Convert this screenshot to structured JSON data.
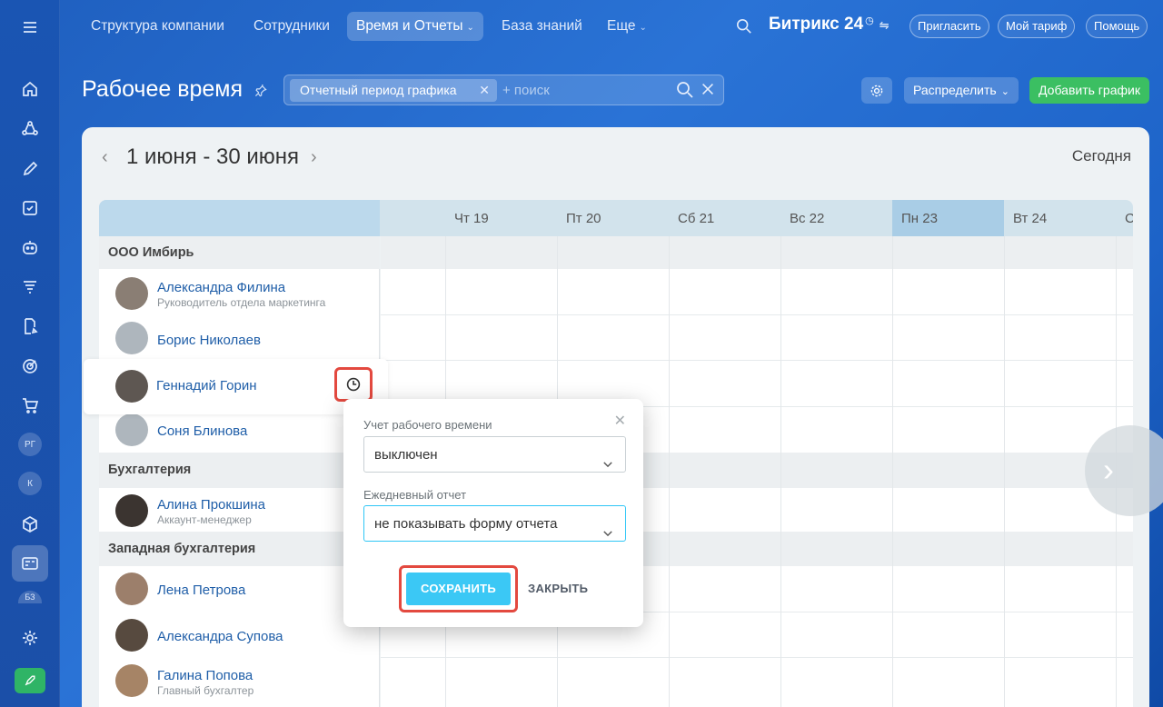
{
  "topnav": {
    "menu_icon": "hamburger-icon",
    "items": [
      {
        "label": "Структура компании"
      },
      {
        "label": "Сотрудники"
      },
      {
        "label": "Время и Отчеты"
      },
      {
        "label": "База знаний"
      },
      {
        "label": "Еще"
      }
    ],
    "brand": "Битрикс 24",
    "invite": "Пригласить",
    "tariff": "Мой тариф",
    "help": "Помощь"
  },
  "sidebar": {
    "badges": [
      "РГ",
      "К",
      "БЗ"
    ]
  },
  "header": {
    "title": "Рабочее время",
    "filter_chip": "Отчетный период графика",
    "search_placeholder": "+ поиск",
    "distribute": "Распределить",
    "add_schedule": "Добавить график"
  },
  "calendar": {
    "range": "1 июня - 30 июня",
    "today": "Сегодня",
    "days": [
      "Чт 19",
      "Пт 20",
      "Сб 21",
      "Вс 22",
      "Пн 23",
      "Вт 24",
      "С"
    ]
  },
  "groups": [
    {
      "name": "ООО Имбирь"
    },
    {
      "name": "Бухгалтерия"
    },
    {
      "name": "Западная бухгалтерия"
    }
  ],
  "employees": [
    {
      "name": "Александра Филина",
      "position": "Руководитель отдела маркетинга"
    },
    {
      "name": "Борис Николаев",
      "position": ""
    },
    {
      "name": "Геннадий Горин",
      "position": ""
    },
    {
      "name": "Соня Блинова",
      "position": ""
    },
    {
      "name": "Алина Прокшина",
      "position": "Аккаунт-менеджер"
    },
    {
      "name": "Лена Петрова",
      "position": ""
    },
    {
      "name": "Александра Супова",
      "position": ""
    },
    {
      "name": "Галина Попова",
      "position": "Главный бухгалтер"
    }
  ],
  "popup": {
    "time_label": "Учет рабочего времени",
    "time_value": "выключен",
    "report_label": "Ежедневный отчет",
    "report_value": "не показывать форму отчета",
    "save": "СОХРАНИТЬ",
    "close": "ЗАКРЫТЬ"
  }
}
